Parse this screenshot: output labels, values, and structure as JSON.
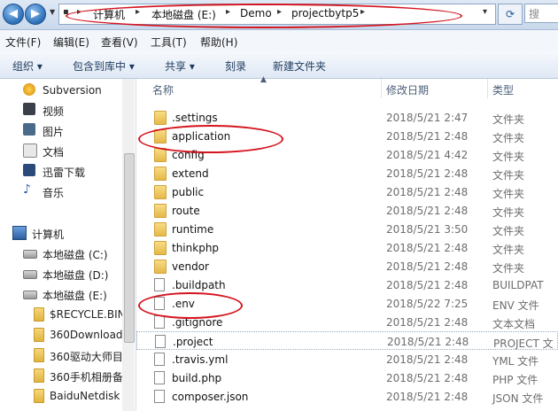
{
  "address": {
    "crumbs": [
      "计算机",
      "本地磁盘 (E:)",
      "Demo",
      "projectbytp5"
    ],
    "search_placeholder": "搜"
  },
  "menu": [
    "文件(F)",
    "编辑(E)",
    "查看(V)",
    "工具(T)",
    "帮助(H)"
  ],
  "toolbar": [
    "组织 ▾",
    "包含到库中 ▾",
    "共享 ▾",
    "刻录",
    "新建文件夹"
  ],
  "nav": {
    "libraries": [
      "Subversion",
      "视频",
      "图片",
      "文档",
      "迅雷下载",
      "音乐"
    ],
    "computer": "计算机",
    "drives": [
      "本地磁盘 (C:)",
      "本地磁盘 (D:)",
      "本地磁盘 (E:)"
    ],
    "folders": [
      "$RECYCLE.BIN",
      "360Download",
      "360驱动大师目",
      "360手机相册备",
      "BaiduNetdisk"
    ]
  },
  "columns": {
    "name": "名称",
    "date": "修改日期",
    "type": "类型"
  },
  "files": [
    {
      "name": ".settings",
      "date": "2018/5/21 2:47",
      "type": "文件夹",
      "kind": "folder"
    },
    {
      "name": "application",
      "date": "2018/5/21 2:48",
      "type": "文件夹",
      "kind": "folder"
    },
    {
      "name": "config",
      "date": "2018/5/21 4:42",
      "type": "文件夹",
      "kind": "folder"
    },
    {
      "name": "extend",
      "date": "2018/5/21 2:48",
      "type": "文件夹",
      "kind": "folder"
    },
    {
      "name": "public",
      "date": "2018/5/21 2:48",
      "type": "文件夹",
      "kind": "folder"
    },
    {
      "name": "route",
      "date": "2018/5/21 2:48",
      "type": "文件夹",
      "kind": "folder"
    },
    {
      "name": "runtime",
      "date": "2018/5/21 3:50",
      "type": "文件夹",
      "kind": "folder"
    },
    {
      "name": "thinkphp",
      "date": "2018/5/21 2:48",
      "type": "文件夹",
      "kind": "folder"
    },
    {
      "name": "vendor",
      "date": "2018/5/21 2:48",
      "type": "文件夹",
      "kind": "folder"
    },
    {
      "name": ".buildpath",
      "date": "2018/5/21 2:48",
      "type": "BUILDPAT",
      "kind": "file"
    },
    {
      "name": ".env",
      "date": "2018/5/22 7:25",
      "type": "ENV 文件",
      "kind": "file"
    },
    {
      "name": ".gitignore",
      "date": "2018/5/21 2:48",
      "type": "文本文档",
      "kind": "file"
    },
    {
      "name": ".project",
      "date": "2018/5/21 2:48",
      "type": "PROJECT 文",
      "kind": "file"
    },
    {
      "name": ".travis.yml",
      "date": "2018/5/21 2:48",
      "type": "YML 文件",
      "kind": "file"
    },
    {
      "name": "build.php",
      "date": "2018/5/21 2:48",
      "type": "PHP 文件",
      "kind": "file"
    },
    {
      "name": "composer.json",
      "date": "2018/5/21 2:48",
      "type": "JSON 文件",
      "kind": "file"
    }
  ],
  "colors": {
    "annotation": "#d4141e"
  }
}
